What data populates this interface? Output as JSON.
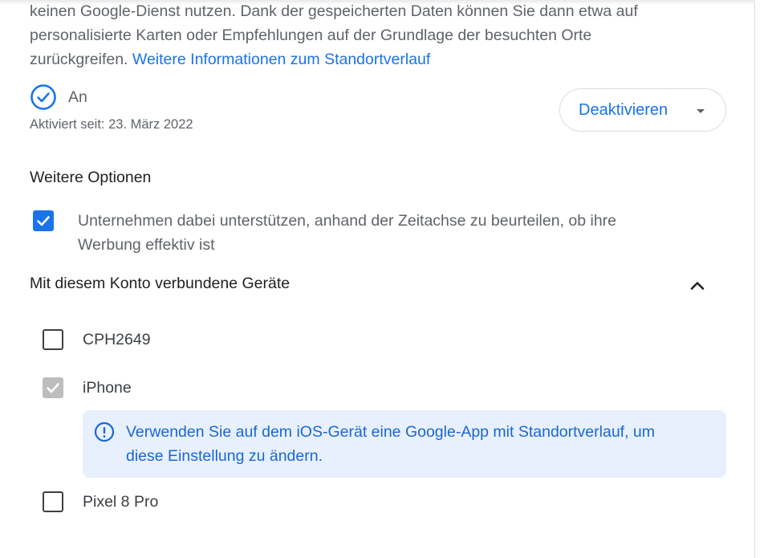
{
  "intro": {
    "line1": "keinen Google-Dienst nutzen. Dank der gespeicherten Daten können Sie dann etwa auf",
    "line2": "personalisierte Karten oder Empfehlungen auf der Grundlage der besuchten Orte",
    "line3_text": "zurückgreifen.",
    "link": "Weitere Informationen zum Standortverlauf"
  },
  "status": {
    "label": "An",
    "since": "Aktiviert seit: 23. März 2022",
    "icon": "check-circle-icon",
    "icon_color": "#1a73e8"
  },
  "deactivate_button": {
    "label": "Deaktivieren",
    "icon": "dropdown-caret-icon"
  },
  "options": {
    "title": "Weitere Optionen",
    "items": [
      {
        "line1": "Unternehmen dabei unterstützen, anhand der Zeitachse zu beurteilen, ob ihre",
        "line2": "Werbung effektiv ist",
        "checked": true
      }
    ]
  },
  "devices": {
    "title": "Mit diesem Konto verbundene Geräte",
    "expanded": true,
    "items": [
      {
        "name": "CPH2649",
        "checked": false,
        "disabled": false
      },
      {
        "name": "iPhone",
        "checked": true,
        "disabled": true
      },
      {
        "name": "Pixel 8 Pro",
        "checked": false,
        "disabled": false
      }
    ],
    "info": {
      "icon": "info-icon",
      "line1": "Verwenden Sie auf dem iOS-Gerät eine Google-App mit Standortverlauf, um",
      "line2": "diese Einstellung zu ändern."
    }
  },
  "colors": {
    "accent": "#1a73e8",
    "info_bg": "#e8f0fe",
    "info_text": "#1967d2",
    "text_secondary": "#5f6368"
  }
}
